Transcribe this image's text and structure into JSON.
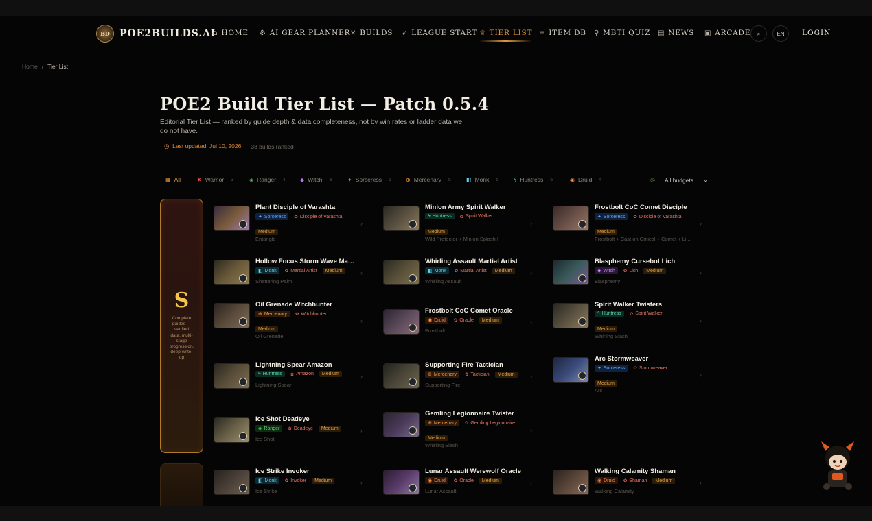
{
  "nav": {
    "brand": "POE2BUILDS.AI",
    "brand_mark": "BD",
    "items": [
      {
        "label": "HOME",
        "icon": "⌂"
      },
      {
        "label": "AI GEAR PLANNER",
        "icon": "⚙"
      },
      {
        "label": "BUILDS",
        "icon": "✕"
      },
      {
        "label": "LEAGUE START",
        "icon": "➶"
      },
      {
        "label": "TIER LIST",
        "icon": "♕"
      },
      {
        "label": "ITEM DB",
        "icon": "≡"
      },
      {
        "label": "MBTI QUIZ",
        "icon": "⚲"
      },
      {
        "label": "NEWS",
        "icon": "▤"
      },
      {
        "label": "ARCADE",
        "icon": "▣"
      }
    ],
    "search_icon": "⌕",
    "lang": "EN",
    "login": "LOGIN"
  },
  "breadcrumb": {
    "home": "Home",
    "sep": "/",
    "current": "Tier List"
  },
  "page": {
    "title": "POE2 Build Tier List — Patch 0.5.4",
    "description": "Editorial Tier List — ranked by guide depth & data completeness, not by win rates or ladder data we do not have.",
    "updated_icon": "◷",
    "updated": "Last updated: Jul 10, 2026",
    "count": "38 builds ranked"
  },
  "filters": [
    {
      "label": "All",
      "icon": "▦",
      "color": "#e39a3e",
      "count": ""
    },
    {
      "label": "Warrior",
      "icon": "✖",
      "color": "#e05050",
      "count": "3"
    },
    {
      "label": "Ranger",
      "icon": "◈",
      "color": "#5fdc6a",
      "count": "4"
    },
    {
      "label": "Witch",
      "icon": "◆",
      "color": "#b07ae8",
      "count": "3"
    },
    {
      "label": "Sorceress",
      "icon": "✦",
      "color": "#4a8ef0",
      "count": "5"
    },
    {
      "label": "Mercenary",
      "icon": "⊕",
      "color": "#f09a44",
      "count": "5"
    },
    {
      "label": "Monk",
      "icon": "◧",
      "color": "#5fd3ea",
      "count": "5"
    },
    {
      "label": "Huntress",
      "icon": "ϟ",
      "color": "#4fd8a8",
      "count": "5"
    },
    {
      "label": "Druid",
      "icon": "◉",
      "color": "#f28a44",
      "count": "4"
    }
  ],
  "budget": {
    "icon": "◎",
    "label": "All budgets",
    "chevron": "⌄"
  },
  "tier": {
    "letter": "S",
    "description": "Complete guides — verified data, multi-stage progression, deep write-up"
  },
  "builds": [
    {
      "name": "Plant Disciple of Varashta",
      "class": "Sorceress",
      "class_icon": "✦",
      "ascendancy": "Disciple of Varashta",
      "budget": "Medium",
      "skills": "Entangle",
      "tone": [
        "#3a2c40",
        "#7a5a3a",
        "#9b7ab0"
      ]
    },
    {
      "name": "Minion Army Spirit Walker",
      "class": "Huntress",
      "class_icon": "ϟ",
      "ascendancy": "Spirit Walker",
      "budget": "Medium",
      "skills": "Wild Protector + Minion Splash I",
      "tone": [
        "#2a2a24",
        "#5a5040",
        "#8a7a60"
      ]
    },
    {
      "name": "Frostbolt CoC Comet Disciple",
      "class": "Sorceress",
      "class_icon": "✦",
      "ascendancy": "Disciple of Varashta",
      "budget": "Medium",
      "skills": "Frostbolt + Cast on Critical + Comet + Li...",
      "tone": [
        "#3a2a2a",
        "#6a5048",
        "#9a7868"
      ]
    },
    {
      "name": "Hollow Focus Storm Wave Martial Artist",
      "class": "Monk",
      "class_icon": "◧",
      "ascendancy": "Martial Artist",
      "budget": "Medium",
      "skills": "Shattering Palm",
      "tone": [
        "#2e2a20",
        "#6a5a3a",
        "#8a7a52"
      ]
    },
    {
      "name": "Whirling Assault Martial Artist",
      "class": "Monk",
      "class_icon": "◧",
      "ascendancy": "Martial Artist",
      "budget": "Medium",
      "skills": "Whirling Assault",
      "tone": [
        "#2a2a22",
        "#5a5038",
        "#7a7050"
      ]
    },
    {
      "name": "Blasphemy Cursebot Lich",
      "class": "Witch",
      "class_icon": "◆",
      "ascendancy": "Lich",
      "budget": "Medium",
      "skills": "Blasphemy",
      "tone": [
        "#1e2a30",
        "#3a5a5a",
        "#7a5a9a"
      ]
    },
    {
      "name": "Oil Grenade Witchhunter",
      "class": "Mercenary",
      "class_icon": "⊕",
      "ascendancy": "Witchhunter",
      "budget": "Medium",
      "skills": "Oil Grenade",
      "tone": [
        "#2a2420",
        "#5a4a3a",
        "#7a6a58"
      ]
    },
    {
      "name": "Frostbolt CoC Comet Oracle",
      "class": "Druid",
      "class_icon": "◉",
      "ascendancy": "Oracle",
      "budget": "Medium",
      "skills": "Frostbolt",
      "tone": [
        "#2e2430",
        "#5a4a5a",
        "#8a6a7a"
      ]
    },
    {
      "name": "Spirit Walker Twisters",
      "class": "Huntress",
      "class_icon": "ϟ",
      "ascendancy": "Spirit Walker",
      "budget": "Medium",
      "skills": "Whirling Slash",
      "tone": [
        "#2a2822",
        "#5a5240",
        "#8a7a5a"
      ]
    },
    {
      "name": "Lightning Spear Amazon",
      "class": "Huntress",
      "class_icon": "ϟ",
      "ascendancy": "Amazon",
      "budget": "Medium",
      "skills": "Lightning Spear",
      "tone": [
        "#2a2620",
        "#5a4e3a",
        "#7a6e52"
      ]
    },
    {
      "name": "Supporting Fire Tactician",
      "class": "Mercenary",
      "class_icon": "⊕",
      "ascendancy": "Tactician",
      "budget": "Medium",
      "skills": "Supporting Fire",
      "tone": [
        "#22221e",
        "#4a4638",
        "#6a6450"
      ]
    },
    {
      "name": "Arc Stormweaver",
      "class": "Sorceress",
      "class_icon": "✦",
      "ascendancy": "Stormweaver",
      "budget": "Medium",
      "skills": "Arc",
      "tone": [
        "#1e2640",
        "#3a4a7a",
        "#7a8ab0"
      ]
    },
    {
      "name": "Ice Shot Deadeye",
      "class": "Ranger",
      "class_icon": "◈",
      "ascendancy": "Deadeye",
      "budget": "Medium",
      "skills": "Ice Shot",
      "tone": [
        "#2a2a22",
        "#6a6048",
        "#9a9070"
      ]
    },
    {
      "name": "Gemling Legionnaire Twister",
      "class": "Mercenary",
      "class_icon": "⊕",
      "ascendancy": "Gemling Legionnaire",
      "budget": "Medium",
      "skills": "Whirling Slash",
      "tone": [
        "#2a2430",
        "#4a3a5a",
        "#7a6a8a"
      ]
    },
    {
      "name": "Ice Strike Invoker",
      "class": "Monk",
      "class_icon": "◧",
      "ascendancy": "Invoker",
      "budget": "Medium",
      "skills": "Ice Strike",
      "tone": [
        "#262220",
        "#4a4038",
        "#6a6050"
      ]
    },
    {
      "name": "Lunar Assault Werewolf Oracle",
      "class": "Druid",
      "class_icon": "◉",
      "ascendancy": "Oracle",
      "budget": "Medium",
      "skills": "Lunar Assault",
      "tone": [
        "#2a1e30",
        "#5a3a6a",
        "#8a7aa0"
      ]
    },
    {
      "name": "Walking Calamity Shaman",
      "class": "Druid",
      "class_icon": "◉",
      "ascendancy": "Shaman",
      "budget": "Medium",
      "skills": "Walking Calamity",
      "tone": [
        "#2a2220",
        "#5a4638",
        "#8a6a58"
      ]
    }
  ],
  "chevron": "›"
}
